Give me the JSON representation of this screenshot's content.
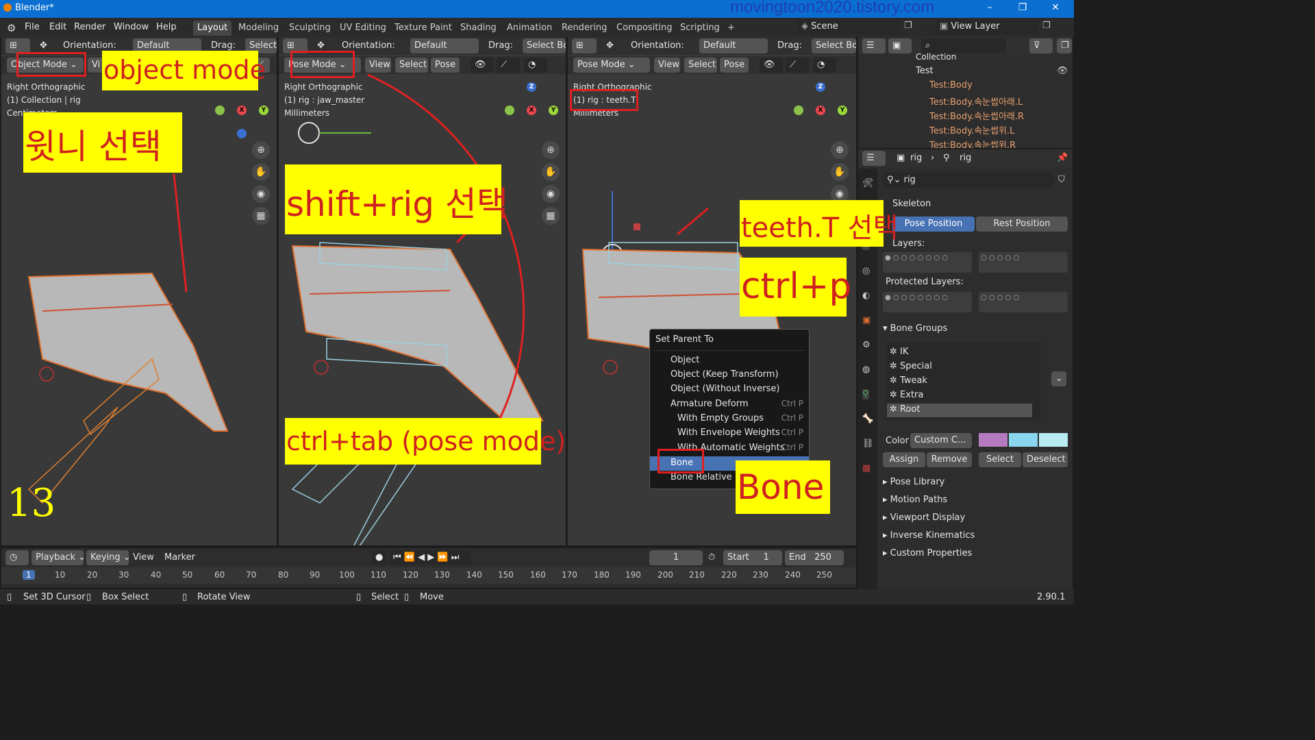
{
  "window": {
    "title": "Blender*",
    "watermark": "movingtoon2020.tistory.com",
    "version": "2.90.1"
  },
  "menus": [
    "File",
    "Edit",
    "Render",
    "Window",
    "Help"
  ],
  "workspaces": [
    "Layout",
    "Modeling",
    "Sculpting",
    "UV Editing",
    "Texture Paint",
    "Shading",
    "Animation",
    "Rendering",
    "Compositing",
    "Scripting"
  ],
  "scene": {
    "name": "Scene",
    "view_layer": "View Layer"
  },
  "viewport_common": {
    "orientation_label": "Orientation:",
    "orientation_value": "Default",
    "drag_label": "Drag:",
    "drag_value": "Select Bo",
    "drag_value_short": "Select",
    "menu_view": "View",
    "menu_select": "Select",
    "menu_pose": "Pose"
  },
  "vp1": {
    "mode": "Object Mode",
    "view_partial": "Vi",
    "info1": "Right Orthographic",
    "info2": "(1) Collection | rig",
    "info3": "Centimeters",
    "orientation_label_partial": "Orientation:",
    "orientation_value": "Default",
    "drag_label": "Drag:"
  },
  "vp2": {
    "mode": "Pose Mode",
    "info1": "Right Orthographic",
    "info2": "(1) rig : jaw_master",
    "info3": "Millimeters"
  },
  "vp3": {
    "mode": "Pose Mode",
    "info1": "Right Orthographic",
    "info2": "(1) rig : teeth.T",
    "info3": "Millimeters"
  },
  "annotations": {
    "object_mode": "object mode",
    "select_wisdom": "윗니 선택",
    "shift_rig": "shift+rig 선택",
    "ctrl_tab": "ctrl+tab (pose mode)",
    "teeth_t": "teeth.T 선택",
    "ctrl_p": "ctrl+p",
    "bone": "Bone",
    "step_number": "13"
  },
  "context_menu": {
    "title": "Set Parent To",
    "items": [
      {
        "label": "Object",
        "shortcut": ""
      },
      {
        "label": "Object (Keep Transform)",
        "shortcut": ""
      },
      {
        "label": "Object (Without Inverse)",
        "shortcut": ""
      },
      {
        "label": "Armature Deform",
        "shortcut": "Ctrl P"
      },
      {
        "label": "With Empty Groups",
        "shortcut": "Ctrl P"
      },
      {
        "label": "With Envelope Weights",
        "shortcut": "Ctrl P"
      },
      {
        "label": "With Automatic Weights",
        "shortcut": "Ctrl P"
      },
      {
        "label": "Bone",
        "shortcut": ""
      },
      {
        "label": "Bone Relative",
        "shortcut": ""
      }
    ]
  },
  "outliner": {
    "items": [
      "Collection",
      "Test",
      "Test:Body",
      "Test:Body.속눈썹아래.L",
      "Test:Body.속눈썹아래.R",
      "Test:Body.속눈썹위.L",
      "Test:Body.속눈썹위.R"
    ]
  },
  "properties": {
    "breadcrumb_obj": "rig",
    "breadcrumb_data": "rig",
    "data_name": "rig",
    "skeleton_label": "Skeleton",
    "pose_position": "Pose Position",
    "rest_position": "Rest Position",
    "layers_label": "Layers:",
    "protected_layers_label": "Protected Layers:",
    "bone_groups_label": "Bone Groups",
    "bone_groups": [
      "IK",
      "Special",
      "Tweak",
      "Extra",
      "Root"
    ],
    "color_label": "Color",
    "color_value": "Custom C...",
    "assign": "Assign",
    "remove": "Remove",
    "select": "Select",
    "deselect": "Deselect",
    "collapsed_panels": [
      "Pose Library",
      "Motion Paths",
      "Viewport Display",
      "Inverse Kinematics",
      "Custom Properties"
    ]
  },
  "timeline": {
    "playback": "Playback",
    "keying": "Keying",
    "view": "View",
    "marker": "Marker",
    "current_frame": "1",
    "start_label": "Start",
    "start": "1",
    "end_label": "End",
    "end": "250",
    "ticks": [
      "1",
      "10",
      "20",
      "30",
      "40",
      "50",
      "60",
      "70",
      "80",
      "90",
      "100",
      "110",
      "120",
      "130",
      "140",
      "150",
      "160",
      "170",
      "180",
      "190",
      "200",
      "210",
      "220",
      "230",
      "240",
      "250"
    ]
  },
  "statusbar": {
    "set_cursor": "Set 3D Cursor",
    "box_select": "Box Select",
    "rotate_view": "Rotate View",
    "select": "Select",
    "move": "Move"
  },
  "colors": {
    "accent": "#4772b3",
    "annotation_bg": "#ffff00",
    "annotation_text": "#d02020",
    "highlight_box": "#e02020"
  }
}
